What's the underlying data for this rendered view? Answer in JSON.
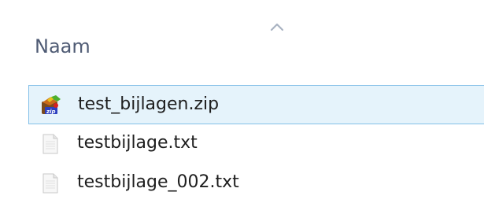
{
  "header": {
    "column_label": "Naam",
    "sort_icon": "sort-ascending-chevron-icon"
  },
  "files": [
    {
      "name": "test_bijlagen.zip",
      "icon": "zip-archive-icon",
      "selected": true
    },
    {
      "name": "testbijlage.txt",
      "icon": "text-file-icon",
      "selected": false
    },
    {
      "name": "testbijlage_002.txt",
      "icon": "text-file-icon",
      "selected": false
    }
  ],
  "colors": {
    "selection_fill": "#e5f3fb",
    "selection_border": "#84c0e8",
    "header_text": "#4f5b74"
  }
}
